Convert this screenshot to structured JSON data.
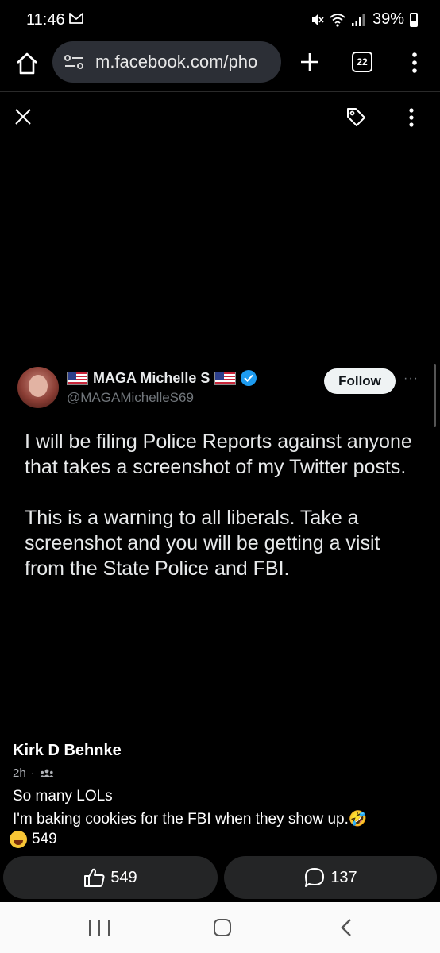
{
  "status_bar": {
    "time": "11:46",
    "battery": "39%",
    "icons": [
      "mail-icon",
      "mute-icon",
      "wifi-icon",
      "signal-icon",
      "battery-icon"
    ]
  },
  "browser": {
    "url": "m.facebook.com/pho",
    "tab_count": "22"
  },
  "post": {
    "tweet": {
      "display_name": "MAGA Michelle S",
      "handle": "@MAGAMichelleS69",
      "follow_label": "Follow",
      "more_label": "···",
      "text_paragraphs": [
        "I will be filing Police Reports against anyone that takes a screenshot of my Twitter posts.",
        "This is a warning to all liberals. Take a screenshot and you will be getting a visit from the State Police and FBI."
      ]
    },
    "comment": {
      "author": "Kirk D Behnke",
      "time": "2h",
      "separator": "·",
      "lines": [
        "So many LOLs",
        "I'm baking cookies for the FBI when they show up.🤣"
      ]
    },
    "reaction_count": "549",
    "like_count": "549",
    "comment_count": "137"
  },
  "colors": {
    "background": "#000000",
    "pill": "#2c2f36",
    "action_button": "#242526",
    "verified": "#1d9bf0",
    "nav_bar": "#fafafa"
  }
}
